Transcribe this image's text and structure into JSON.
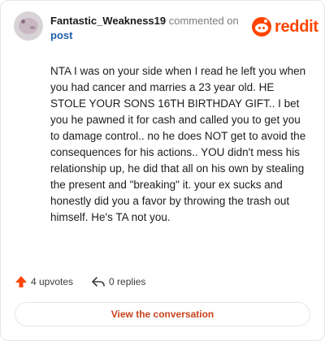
{
  "header": {
    "username": "Fantastic_Weakness19",
    "action_text": "commented on",
    "post_link": "post",
    "brand": "reddit"
  },
  "comment": {
    "text": "NTA I was on your side when I read he left you when you had cancer and marries a 23 year old. HE STOLE YOUR SONS 16TH BIRTHDAY GIFT.. I bet you he pawned it for cash and called you to get you to damage control.. no he does NOT get to avoid the consequences for his actions.. YOU didn't mess his relationship up, he did that all on his own by stealing the present and \"breaking\" it. your ex sucks and honestly did you a favor by throwing the trash out himself. He's TA not you."
  },
  "footer": {
    "upvotes": "4 upvotes",
    "replies": "0 replies",
    "view_button": "View the conversation"
  },
  "colors": {
    "brand": "#ff4500",
    "link": "#1d5fa8",
    "button_text": "#c8421a"
  },
  "icons": {
    "avatar": "user-avatar",
    "logo": "reddit-snoo-icon",
    "upvote": "upvote-arrow-icon",
    "reply": "reply-arrow-icon"
  }
}
